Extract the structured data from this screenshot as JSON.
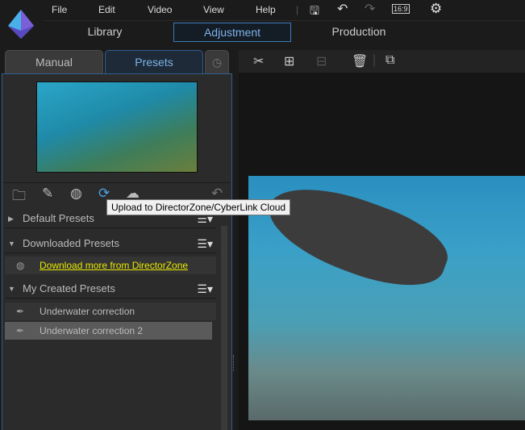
{
  "menu": [
    "File",
    "Edit",
    "Video",
    "View",
    "Help"
  ],
  "toolbar_icons": [
    "save-icon",
    "undo-icon",
    "redo-icon",
    "aspect-ratio-icon",
    "settings-icon"
  ],
  "aspect_ratio": "16:9",
  "nav": {
    "library": "Library",
    "adjustment": "Adjustment",
    "production": "Production"
  },
  "panel_tabs": {
    "manual": "Manual",
    "presets": "Presets"
  },
  "tooltip": "Upload to DirectorZone/CyberLink Cloud",
  "sections": {
    "default": "Default Presets",
    "downloaded": "Downloaded Presets",
    "download_link": "Download more from DirectorZone",
    "created": "My Created Presets",
    "items": [
      "Underwater correction",
      "Underwater correction 2"
    ]
  },
  "colors": {
    "accent": "#3d7bb8",
    "link": "#e8e800"
  }
}
